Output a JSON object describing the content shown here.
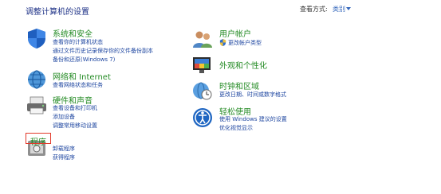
{
  "header": {
    "title": "调整计算机的设置",
    "view_by_label": "查看方式:",
    "view_by_value": "类别"
  },
  "left": [
    {
      "title": "系统和安全",
      "links": [
        "查看你的计算机状态",
        "通过文件历史记录保存你的文件备份副本",
        "备份和还原(Windows 7)"
      ]
    },
    {
      "title": "网络和 Internet",
      "links": [
        "查看网络状态和任务"
      ]
    },
    {
      "title": "硬件和声音",
      "links": [
        "查看设备和打印机",
        "添加设备",
        "调整常用移动设置"
      ]
    },
    {
      "title": "程序",
      "links": [
        "卸载程序",
        "获得程序"
      ]
    }
  ],
  "right": [
    {
      "title": "用户帐户",
      "links": [
        "更改帐户类型"
      ]
    },
    {
      "title": "外观和个性化",
      "links": []
    },
    {
      "title": "时钟和区域",
      "links": [
        "更改日期、时间或数字格式"
      ]
    },
    {
      "title": "轻松使用",
      "links": [
        "使用 Windows 建议的设置",
        "优化视觉显示"
      ]
    }
  ],
  "colors": {
    "title_green": "#248b24",
    "link_blue": "#1e46a0",
    "highlight_red": "#e23a2b"
  }
}
